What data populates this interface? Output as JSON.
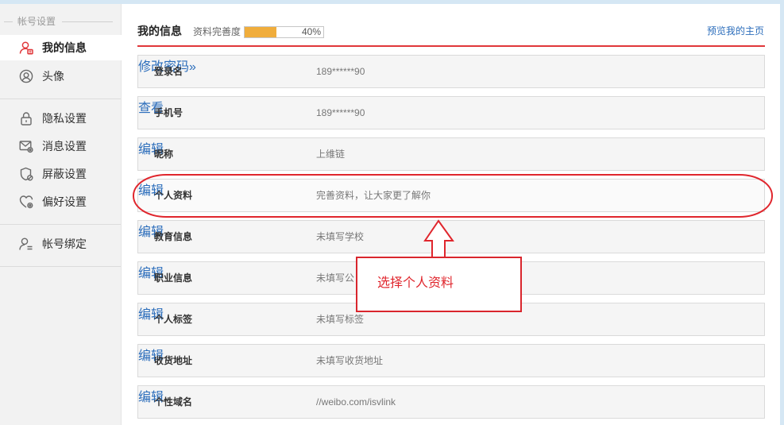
{
  "colors": {
    "accent_red": "#e0373a",
    "link_blue": "#2b6dbb",
    "progress_fill": "#f0ad3c",
    "annotation_red": "#e0262d",
    "sidebar_bg": "#f2f2f2",
    "page_edge_blue": "#d5e7f4"
  },
  "sidebar": {
    "title": "帐号设置",
    "items": [
      {
        "label": "我的信息",
        "icon": "user-icon",
        "active": true
      },
      {
        "label": "头像",
        "icon": "avatar-icon"
      },
      {
        "label": "隐私设置",
        "icon": "lock-icon"
      },
      {
        "label": "消息设置",
        "icon": "envelope-icon"
      },
      {
        "label": "屏蔽设置",
        "icon": "shield-icon"
      },
      {
        "label": "偏好设置",
        "icon": "heart-icon"
      },
      {
        "label": "帐号绑定",
        "icon": "user-link-icon"
      }
    ]
  },
  "header": {
    "title": "我的信息",
    "completeness_label": "资料完善度",
    "completeness_percent": 40,
    "completeness_text": "40%",
    "preview_link": "预览我的主页"
  },
  "rows": [
    {
      "label": "登录名",
      "value": "189******90",
      "action": "修改密码»"
    },
    {
      "label": "手机号",
      "value": "189******90",
      "action": "查看"
    },
    {
      "label": "昵称",
      "value": "上维链",
      "action": "编辑"
    },
    {
      "label": "个人资料",
      "value": "完善资料，让大家更了解你",
      "action": "编辑"
    },
    {
      "label": "教育信息",
      "value": "未填写学校",
      "action": "编辑"
    },
    {
      "label": "职业信息",
      "value": "未填写公",
      "action": "编辑"
    },
    {
      "label": "个人标签",
      "value": "未填写标签",
      "action": "编辑"
    },
    {
      "label": "收货地址",
      "value": "未填写收货地址",
      "action": "编辑"
    },
    {
      "label": "个性域名",
      "value": "//weibo.com/isvlink",
      "action": "编辑"
    }
  ],
  "annotation": {
    "callout_text": "选择个人资料"
  }
}
